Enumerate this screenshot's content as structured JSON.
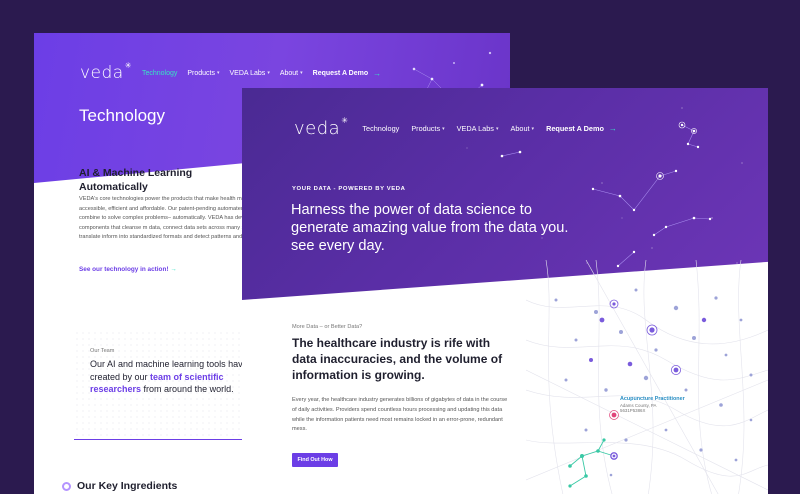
{
  "colors": {
    "accent": "#6c3ee6",
    "highlight": "#39e2c4",
    "background": "#2b1a4f"
  },
  "back_page": {
    "logo": "veda",
    "nav": [
      {
        "label": "Technology",
        "active": true,
        "dropdown": false
      },
      {
        "label": "Products",
        "active": false,
        "dropdown": true
      },
      {
        "label": "VEDA Labs",
        "active": false,
        "dropdown": true
      },
      {
        "label": "About",
        "active": false,
        "dropdown": true
      }
    ],
    "nav_cta": "Request A Demo",
    "title": "Technology",
    "section_heading": "AI & Machine Learning Automatically",
    "section_body": "VEDA's core technologies power the products that make health more accessible, efficient and affordable. Our patent-pending automated systems combine to solve complex problems– automatically. VEDA has developed components that cleanse m data, connect data sets across many systems, translate inform into standardized formats and detect patterns and error.",
    "section_link": "See our technology in action!",
    "team_eyebrow": "Our Team",
    "team_text_before": "Our AI and machine learning tools hav been created by our ",
    "team_text_highlight": "team of scientific researchers",
    "team_text_after": " from around the world.",
    "ingredients_heading": "Our Key Ingredients"
  },
  "front_page": {
    "logo": "veda",
    "nav": [
      {
        "label": "Technology",
        "dropdown": false
      },
      {
        "label": "Products",
        "dropdown": true
      },
      {
        "label": "VEDA Labs",
        "dropdown": true
      },
      {
        "label": "About",
        "dropdown": true
      }
    ],
    "nav_cta": "Request A Demo",
    "eyebrow": "YOUR DATA - POWERED BY VEDA",
    "headline": "Harness the power of data science to generate amazing value from the data you. see every day.",
    "content_eyebrow": "More Data – or Better Data?",
    "content_heading": "The healthcare industry is rife with data inaccuracies, and the volume of information is growing.",
    "content_body": "Every year, the healthcare industry generates billions of gigabytes of data in the course of daily activities. Providers spend countless hours processing and updating this data while the information patients need most remains locked in an error-prone, redundant mess.",
    "cta_button": "Find Out How",
    "map_callout": {
      "title": "Acupuncture Practitioner",
      "location": "Adams County, PA",
      "code": "5631P5386X"
    }
  }
}
